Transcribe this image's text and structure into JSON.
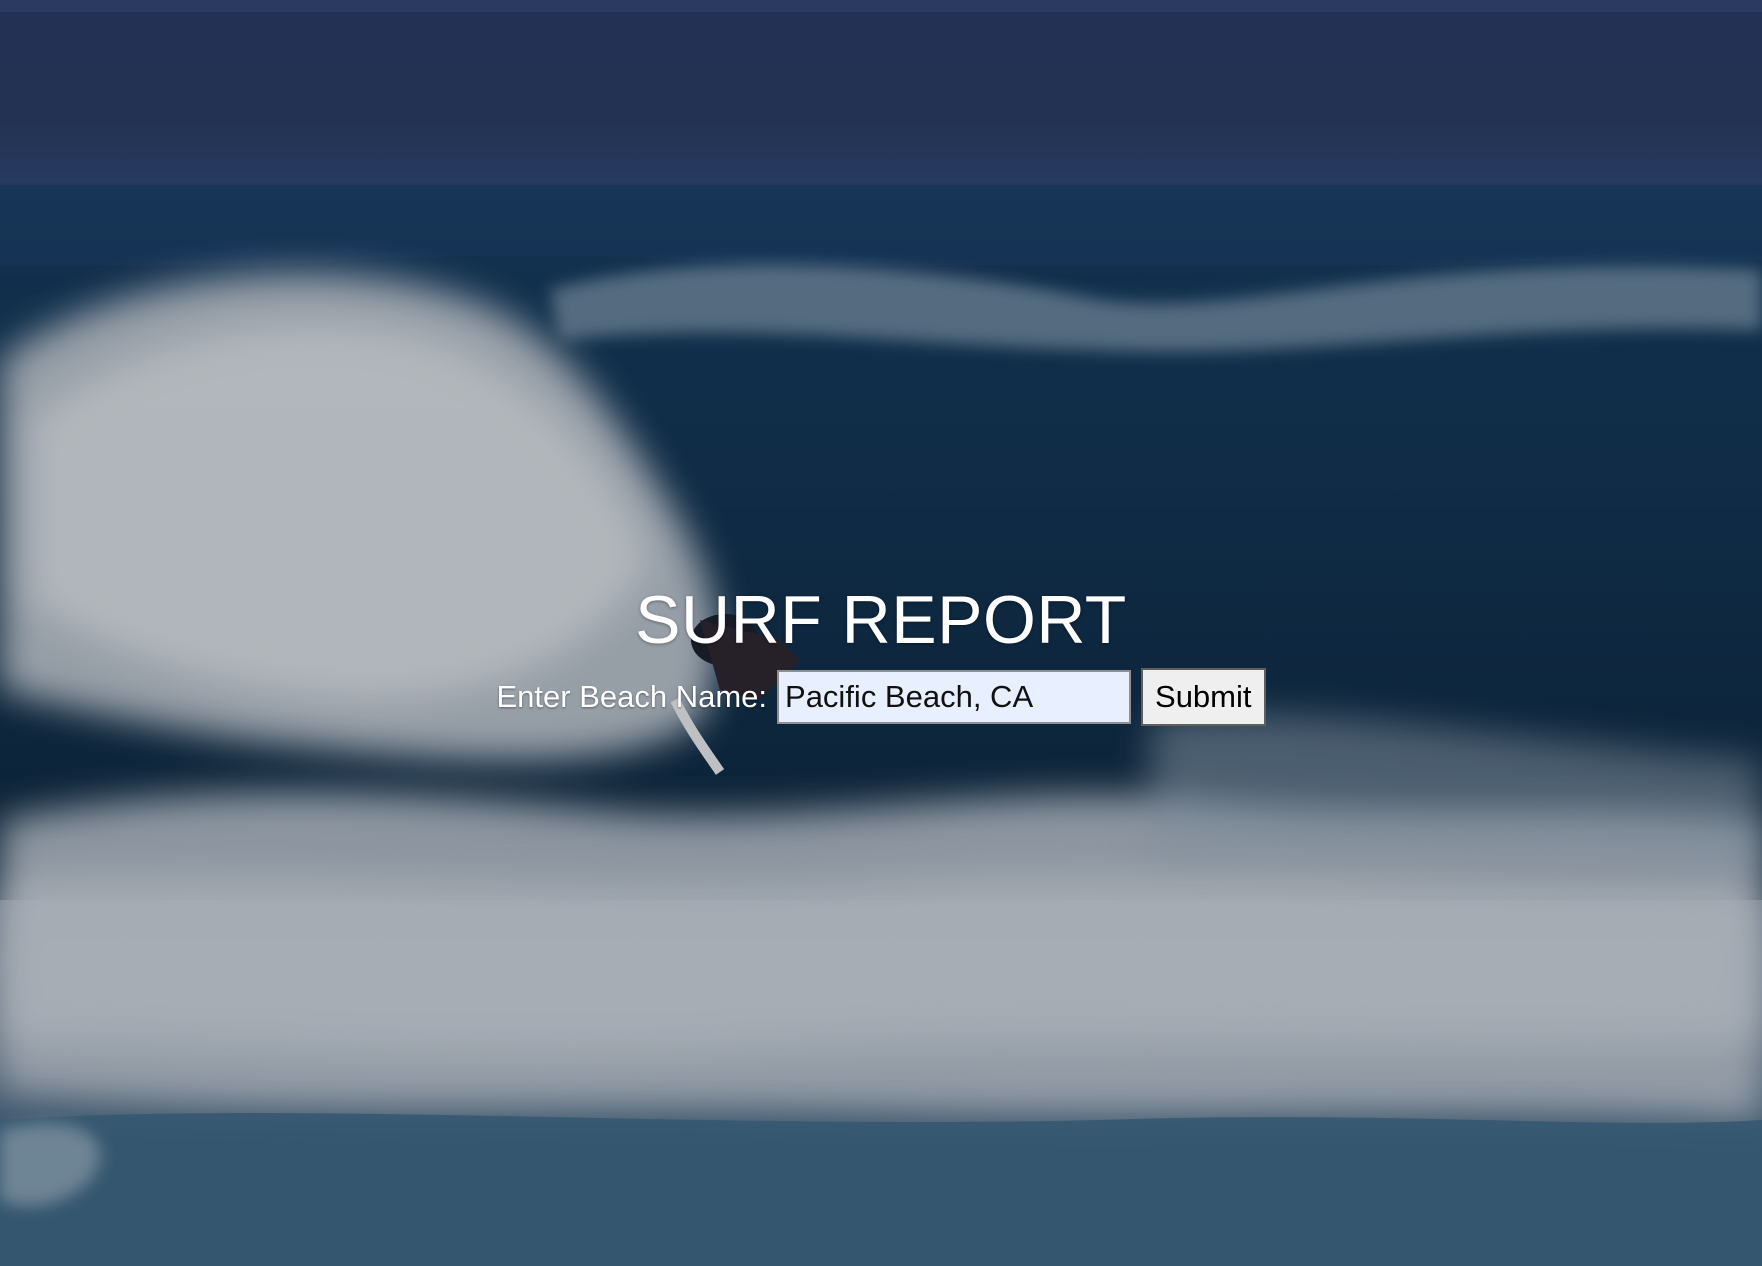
{
  "page": {
    "title": "SURF REPORT"
  },
  "form": {
    "label": "Enter Beach Name:",
    "input_value": "Pacific Beach, CA",
    "submit_label": "Submit"
  },
  "background": {
    "subject": "surfer riding a breaking wave",
    "overlay_tint": "#0f1932"
  }
}
